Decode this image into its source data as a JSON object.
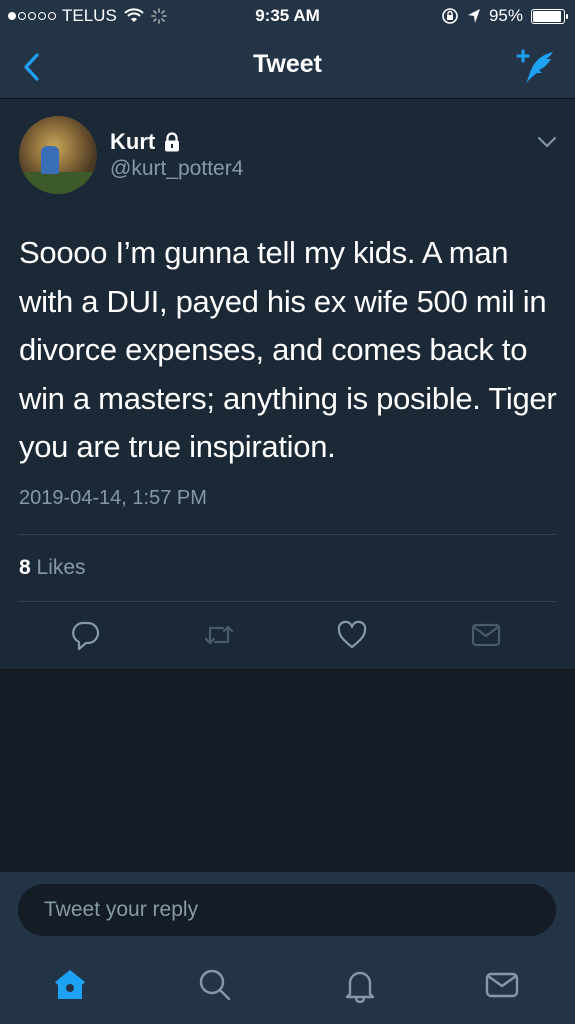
{
  "status_bar": {
    "carrier": "TELUS",
    "time": "9:35 AM",
    "battery": "95%",
    "battery_level": 0.95,
    "signal_bars_filled": 1,
    "signal_bars_total": 5
  },
  "nav": {
    "title": "Tweet",
    "back_icon": "chevron-left-icon",
    "compose_icon": "compose-tweet-icon"
  },
  "tweet": {
    "display_name": "Kurt",
    "protected_icon": "lock-icon",
    "handle": "@kurt_potter4",
    "text": "Soooo I’m gunna tell my kids. A man with a DUI, payed his ex wife 500 mil in divorce expenses, and comes back to win a masters; anything is posible. Tiger you are true inspiration.",
    "timestamp": "2019-04-14, 1:57 PM",
    "likes_count": "8",
    "likes_label": "Likes"
  },
  "actions": [
    "reply-icon",
    "retweet-icon",
    "like-icon",
    "direct-message-icon"
  ],
  "reply": {
    "placeholder": "Tweet your reply"
  },
  "tabs": [
    "home-icon",
    "search-icon",
    "notifications-icon",
    "messages-icon"
  ],
  "colors": {
    "accent": "#1da1f2",
    "background": "#141d26",
    "panel": "#1b2836",
    "bar": "#243447",
    "secondary_text": "#8899a6",
    "icon_muted": "#8899a6"
  }
}
